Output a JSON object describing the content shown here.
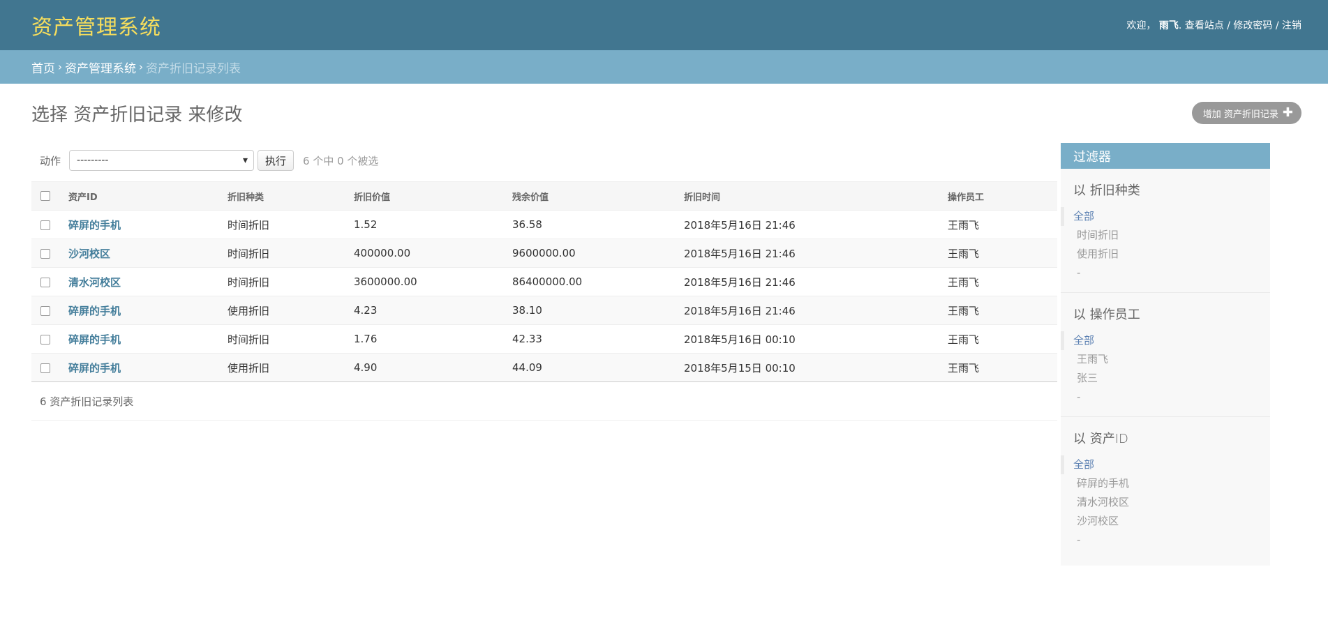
{
  "header": {
    "site_name": "资产管理系统",
    "welcome": "欢迎，",
    "username": "雨飞",
    "view_site": "查看站点",
    "change_password": "修改密码",
    "logout": "注销",
    "sep": " / "
  },
  "breadcrumbs": {
    "home": "首页",
    "app": "资产管理系统",
    "current": "资产折旧记录列表",
    "sep": "›"
  },
  "page": {
    "title": "选择 资产折旧记录 来修改",
    "add_button": "增加 资产折旧记录",
    "add_icon": "plus-icon"
  },
  "actions": {
    "label": "动作",
    "select_value": "---------",
    "go_button": "执行",
    "counter": "6 个中 0 个被选"
  },
  "table": {
    "headers": [
      "资产ID",
      "折旧种类",
      "折旧价值",
      "残余价值",
      "折旧时间",
      "操作员工"
    ],
    "rows": [
      [
        "碎屏的手机",
        "时间折旧",
        "1.52",
        "36.58",
        "2018年5月16日 21:46",
        "王雨飞"
      ],
      [
        "沙河校区",
        "时间折旧",
        "400000.00",
        "9600000.00",
        "2018年5月16日 21:46",
        "王雨飞"
      ],
      [
        "清水河校区",
        "时间折旧",
        "3600000.00",
        "86400000.00",
        "2018年5月16日 21:46",
        "王雨飞"
      ],
      [
        "碎屏的手机",
        "使用折旧",
        "4.23",
        "38.10",
        "2018年5月16日 21:46",
        "王雨飞"
      ],
      [
        "碎屏的手机",
        "时间折旧",
        "1.76",
        "42.33",
        "2018年5月16日 00:10",
        "王雨飞"
      ],
      [
        "碎屏的手机",
        "使用折旧",
        "4.90",
        "44.09",
        "2018年5月15日 00:10",
        "王雨飞"
      ]
    ]
  },
  "paginator": "6 资产折旧记录列表",
  "filter": {
    "title": "过滤器",
    "sections": [
      {
        "heading": "以 折旧种类",
        "items": [
          "全部",
          "时间折旧",
          "使用折旧",
          "-"
        ]
      },
      {
        "heading": "以 操作员工",
        "items": [
          "全部",
          "王雨飞",
          "张三",
          "-"
        ]
      },
      {
        "heading": "以 资产ID",
        "items": [
          "全部",
          "碎屏的手机",
          "清水河校区",
          "沙河校区",
          "-"
        ]
      }
    ]
  },
  "colors": {
    "header_bg": "#417690",
    "breadcrumb_bg": "#79aec8",
    "site_name": "#f5dd5d",
    "link": "#447e9b"
  }
}
